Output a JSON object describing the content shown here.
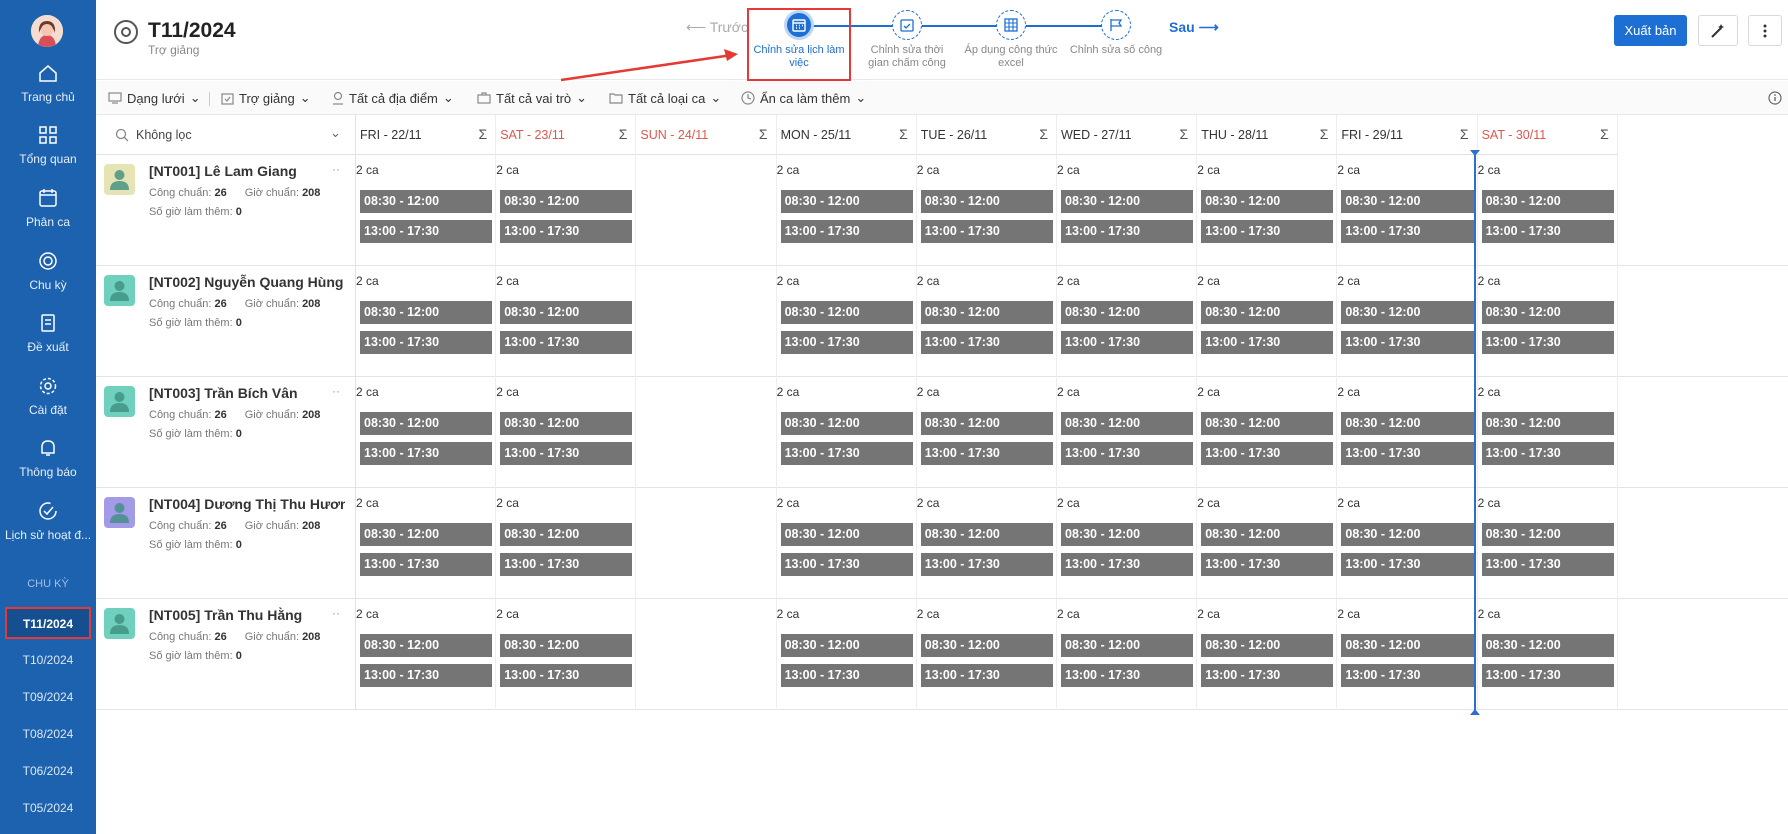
{
  "sidebar": {
    "items": [
      {
        "label": "Trang chủ",
        "icon": "home-icon"
      },
      {
        "label": "Tổng quan",
        "icon": "grid-icon"
      },
      {
        "label": "Phân ca",
        "icon": "calendar-edit-icon"
      },
      {
        "label": "Chu kỳ",
        "icon": "cycle-icon"
      },
      {
        "label": "Đề xuất",
        "icon": "document-icon"
      },
      {
        "label": "Cài đặt",
        "icon": "gear-icon"
      },
      {
        "label": "Thông báo",
        "icon": "bell-icon"
      },
      {
        "label": "Lịch sử hoạt đ...",
        "icon": "check-circle-icon"
      }
    ],
    "section_label": "CHU KỲ",
    "cycles": [
      "T11/2024",
      "T10/2024",
      "T09/2024",
      "T08/2024",
      "T06/2024",
      "T05/2024"
    ],
    "active_cycle": "T11/2024"
  },
  "header": {
    "title": "T11/2024",
    "subtitle": "Trợ giảng",
    "prev_label": "⟵ Trước",
    "next_label": "Sau ⟶",
    "steps": [
      {
        "label": "Chỉnh sửa lịch làm việc",
        "icon": "calendar-icon",
        "active": true
      },
      {
        "label": "Chỉnh sửa thời gian chấm công",
        "icon": "calendar-check-icon",
        "active": false
      },
      {
        "label": "Áp dụng công thức excel",
        "icon": "table-icon",
        "active": false
      },
      {
        "label": "Chỉnh sửa số công",
        "icon": "flag-icon",
        "active": false
      }
    ],
    "publish_label": "Xuất bản"
  },
  "toolbar": {
    "view_label": "Dạng lưới",
    "role_label": "Trợ giảng",
    "location_label": "Tất cả địa điểm",
    "roles_label": "Tất cả vai trò",
    "shift_types_label": "Tất cả loại ca",
    "hide_overtime_label": "Ẩn ca làm thêm"
  },
  "grid": {
    "filter_label": "Không lọc",
    "sigma": "Σ",
    "days": [
      {
        "label": "FRI - 22/11",
        "weekend": false,
        "empty": false
      },
      {
        "label": "SAT - 23/11",
        "weekend": true,
        "empty": false
      },
      {
        "label": "SUN - 24/11",
        "weekend": true,
        "empty": true
      },
      {
        "label": "MON - 25/11",
        "weekend": false,
        "empty": false
      },
      {
        "label": "TUE - 26/11",
        "weekend": false,
        "empty": false
      },
      {
        "label": "WED - 27/11",
        "weekend": false,
        "empty": false
      },
      {
        "label": "THU - 28/11",
        "weekend": false,
        "empty": false
      },
      {
        "label": "FRI - 29/11",
        "weekend": false,
        "empty": false
      },
      {
        "label": "SAT - 30/11",
        "weekend": true,
        "empty": false
      }
    ],
    "shift_count_label": "2 ca",
    "shifts": [
      "08:30 - 12:00",
      "13:00 - 17:30"
    ],
    "std_days_label": "Công chuẩn:",
    "std_hours_label": "Giờ chuẩn:",
    "overtime_label": "Số giờ làm thêm:",
    "employees": [
      {
        "name": "[NT001] Lê Lam Giang",
        "std_days": "26",
        "std_hours": "208",
        "overtime": "0",
        "avatar_color": "#e6e3b4"
      },
      {
        "name": "[NT002] Nguyễn Quang Hùng",
        "std_days": "26",
        "std_hours": "208",
        "overtime": "0",
        "avatar_color": "#6fd0bd"
      },
      {
        "name": "[NT003] Trần Bích Vân",
        "std_days": "26",
        "std_hours": "208",
        "overtime": "0",
        "avatar_color": "#6fd0bd"
      },
      {
        "name": "[NT004] Dương Thị Thu Hương",
        "std_days": "26",
        "std_hours": "208",
        "overtime": "0",
        "avatar_color": "#a39be8"
      },
      {
        "name": "[NT005] Trần Thu Hằng",
        "std_days": "26",
        "std_hours": "208",
        "overtime": "0",
        "avatar_color": "#6fd0bd"
      }
    ]
  },
  "colors": {
    "sidebar": "#1d62ae",
    "accent": "#1d6fd4",
    "shift_block": "#757575",
    "weekend": "#e0564f",
    "annotation": "#e53935"
  }
}
